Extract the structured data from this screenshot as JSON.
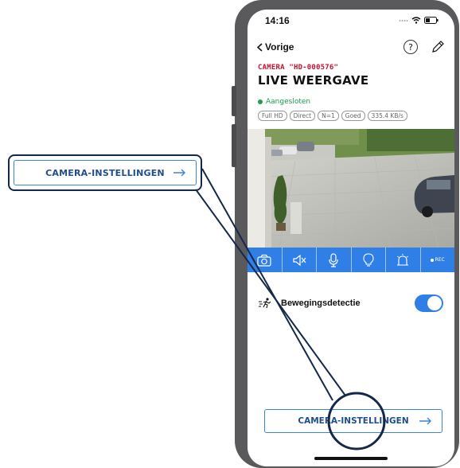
{
  "callout": {
    "button_label": "CAMERA-INSTELLINGEN"
  },
  "status_bar": {
    "time": "14:16"
  },
  "navbar": {
    "back_label": "Vorige",
    "help_label": "?"
  },
  "camera_label": "CAMERA \"HD-000576\"",
  "page_title": "LIVE WEERGAVE",
  "connection_status": "Aangesloten",
  "chips": [
    "Full HD",
    "Direct",
    "N=1",
    "Goed",
    "335.4 KB/s"
  ],
  "toolbar": {
    "items": [
      "snapshot-icon",
      "speaker-mute-icon",
      "microphone-icon",
      "light-bulb-icon",
      "siren-icon",
      "record"
    ],
    "rec_label": "REC"
  },
  "motion": {
    "label": "Bewegingsdetectie",
    "enabled": true
  },
  "settings_button": {
    "label": "CAMERA-INSTELLINGEN"
  },
  "colors": {
    "accent": "#2f7fe6",
    "title_red": "#c8102e",
    "connected_green": "#18a24a",
    "callout_border": "#16284a"
  }
}
